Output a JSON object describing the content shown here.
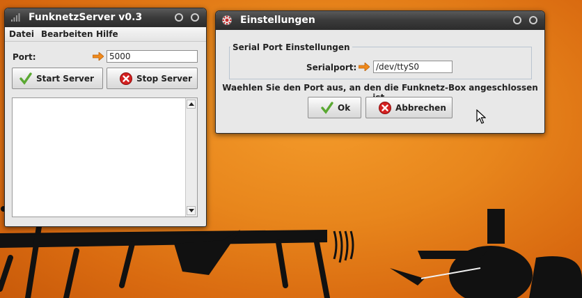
{
  "main_window": {
    "title": "FunknetzServer v0.3",
    "menu": [
      "Datei",
      "Bearbeiten",
      "Hilfe"
    ],
    "port_label": "Port:",
    "port_value": "5000",
    "start_button": "Start Server",
    "stop_button": "Stop Server",
    "log_text": ""
  },
  "dialog": {
    "title": "Einstellungen",
    "group_title": "Serial Port Einstellungen",
    "serialport_label": "Serialport:",
    "serialport_value": "/dev/ttyS0",
    "info_text": "Waehlen Sie den Port aus, an den die Funknetz-Box angeschlossen ist.",
    "ok_button": "Ok",
    "cancel_button": "Abbrechen"
  },
  "icons": {
    "app": "signal-bars-icon",
    "dialog": "gear-icon",
    "arrow": "right-arrow-icon",
    "ok": "checkmark-icon",
    "cancel": "red-x-icon"
  },
  "colors": {
    "titlebar": "#333333",
    "window_bg": "#e8e8e8",
    "desktop": "#e8861c",
    "arrow": "#f08a1c",
    "check": "#5aa832",
    "cancel": "#d42020"
  }
}
